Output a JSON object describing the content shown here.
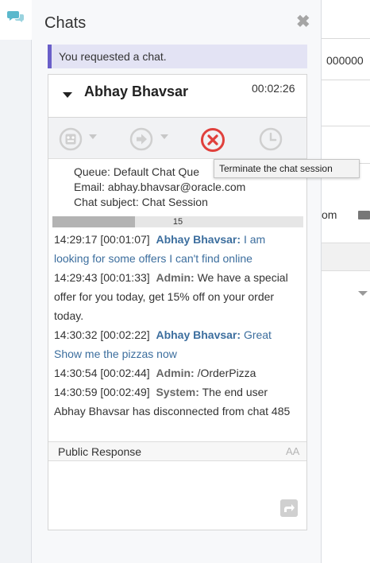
{
  "panel": {
    "title": "Chats",
    "close_glyph": "✖"
  },
  "notice": {
    "text": "You requested a chat."
  },
  "chat": {
    "name": "Abhay Bhavsar",
    "timer": "00:02:26",
    "info": {
      "queue": "Queue: Default Chat Que",
      "email": "Email: abhay.bhavsar@oracle.com",
      "subject": "Chat subject: Chat Session"
    },
    "progress": {
      "value": "15",
      "fill_percent": 33
    },
    "toolbar": {
      "icons": [
        "emoji-icon",
        "forward-icon",
        "terminate-icon",
        "clock-icon"
      ],
      "tooltip": "Terminate the chat session"
    },
    "messages": [
      {
        "ts": "14:29:17 [00:01:07]",
        "who": "Abhay Bhavsar:",
        "text": "I am looking for some offers I can't find online"
      },
      {
        "ts": "14:29:43 [00:01:33]",
        "who": "Admin:",
        "text": "We have a special offer for you today, get 15% off on your order today."
      },
      {
        "ts": "14:30:32 [00:02:22]",
        "who": "Abhay Bhavsar:",
        "text": "Great Show me the pizzas now"
      },
      {
        "ts": "14:30:54 [00:02:44]",
        "who": "Admin:",
        "text": "/OrderPizza"
      },
      {
        "ts": "14:30:59 [00:02:49]",
        "who": "System:",
        "text": "The end user Abhay Bhavsar has disconnected from chat 485"
      }
    ],
    "response": {
      "label": "Public Response",
      "font_toggle": "AA"
    }
  },
  "background": {
    "field_value": "000000",
    "text_fragment": "om"
  },
  "colors": {
    "accent": "#6a5fc9",
    "terminate": "#e0403c",
    "customer_text": "#3c6e9e",
    "chat_icon": "#5bb8cc"
  }
}
